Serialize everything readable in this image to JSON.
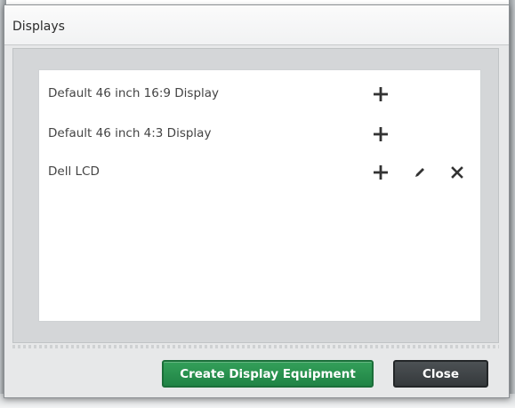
{
  "dialog": {
    "title": "Displays"
  },
  "displays": [
    {
      "name": "Default 46 inch 16:9 Display",
      "actions": [
        "add-icon"
      ]
    },
    {
      "name": "Default 46 inch 4:3 Display",
      "actions": [
        "add-icon"
      ]
    },
    {
      "name": "Dell LCD",
      "actions": [
        "add-icon",
        "edit-pencil-icon",
        "delete-x-icon"
      ]
    }
  ],
  "buttons": {
    "create_label": "Create Display Equipment",
    "close_label": "Close"
  },
  "colors": {
    "primary_button": "#2a8f4e",
    "secondary_button": "#3f4447",
    "icon": "#333333"
  }
}
